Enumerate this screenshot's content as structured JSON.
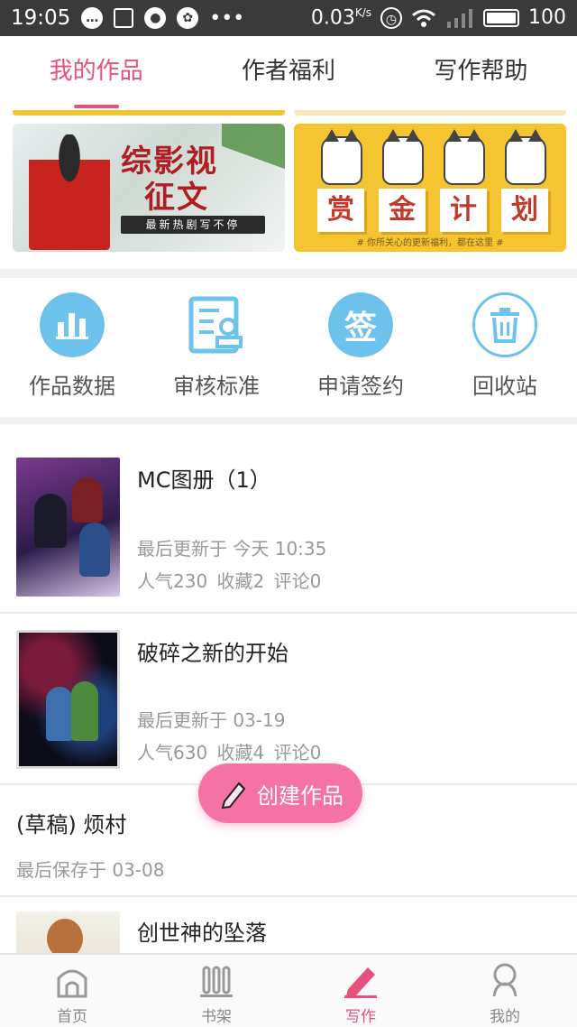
{
  "status_bar": {
    "time": "19:05",
    "net_speed": "0.03",
    "net_unit": "K/s",
    "battery": "100",
    "icons": [
      "chat-icon",
      "mail-icon",
      "account-icon",
      "paw-icon",
      "more-icon",
      "alarm-icon",
      "wifi-icon",
      "signal-icon",
      "battery-icon"
    ]
  },
  "tabs": [
    {
      "label": "我的作品",
      "active": true
    },
    {
      "label": "作者福利",
      "active": false
    },
    {
      "label": "写作帮助",
      "active": false
    }
  ],
  "banners": {
    "left": {
      "title_line1": "综影视",
      "title_line2": "征文",
      "subtitle": "最新热剧写不停"
    },
    "right": {
      "words": [
        "赏",
        "金",
        "计",
        "划"
      ],
      "subtitle": "# 你所关心的更新福利，都在这里 #"
    }
  },
  "quick_actions": [
    {
      "label": "作品数据",
      "icon": "bar-chart-icon"
    },
    {
      "label": "审核标准",
      "icon": "review-doc-icon"
    },
    {
      "label": "申请签约",
      "icon": "sign-icon",
      "glyph": "签"
    },
    {
      "label": "回收站",
      "icon": "trash-icon"
    }
  ],
  "works": [
    {
      "title": "MC图册（1）",
      "updated": "最后更新于 今天 10:35",
      "stats": "人气230  收藏2  评论0"
    },
    {
      "title": "破碎之新的开始",
      "updated": "最后更新于 03-19",
      "stats": "人气630  收藏4  评论0"
    },
    {
      "title": "(草稿) 烦村",
      "updated": "最后保存于 03-08"
    },
    {
      "title": "创世神的坠落"
    }
  ],
  "fab": {
    "label": "创建作品",
    "icon": "pen-icon"
  },
  "bottom_nav": [
    {
      "label": "首页",
      "icon": "home-icon",
      "active": false
    },
    {
      "label": "书架",
      "icon": "bookshelf-icon",
      "active": false
    },
    {
      "label": "写作",
      "icon": "write-pen-icon",
      "active": true
    },
    {
      "label": "我的",
      "icon": "profile-icon",
      "active": false
    }
  ],
  "colors": {
    "accent": "#e8507c",
    "fab": "#f472a4",
    "icon_blue": "#6ec3ec",
    "banner_yellow": "#f4c531"
  }
}
